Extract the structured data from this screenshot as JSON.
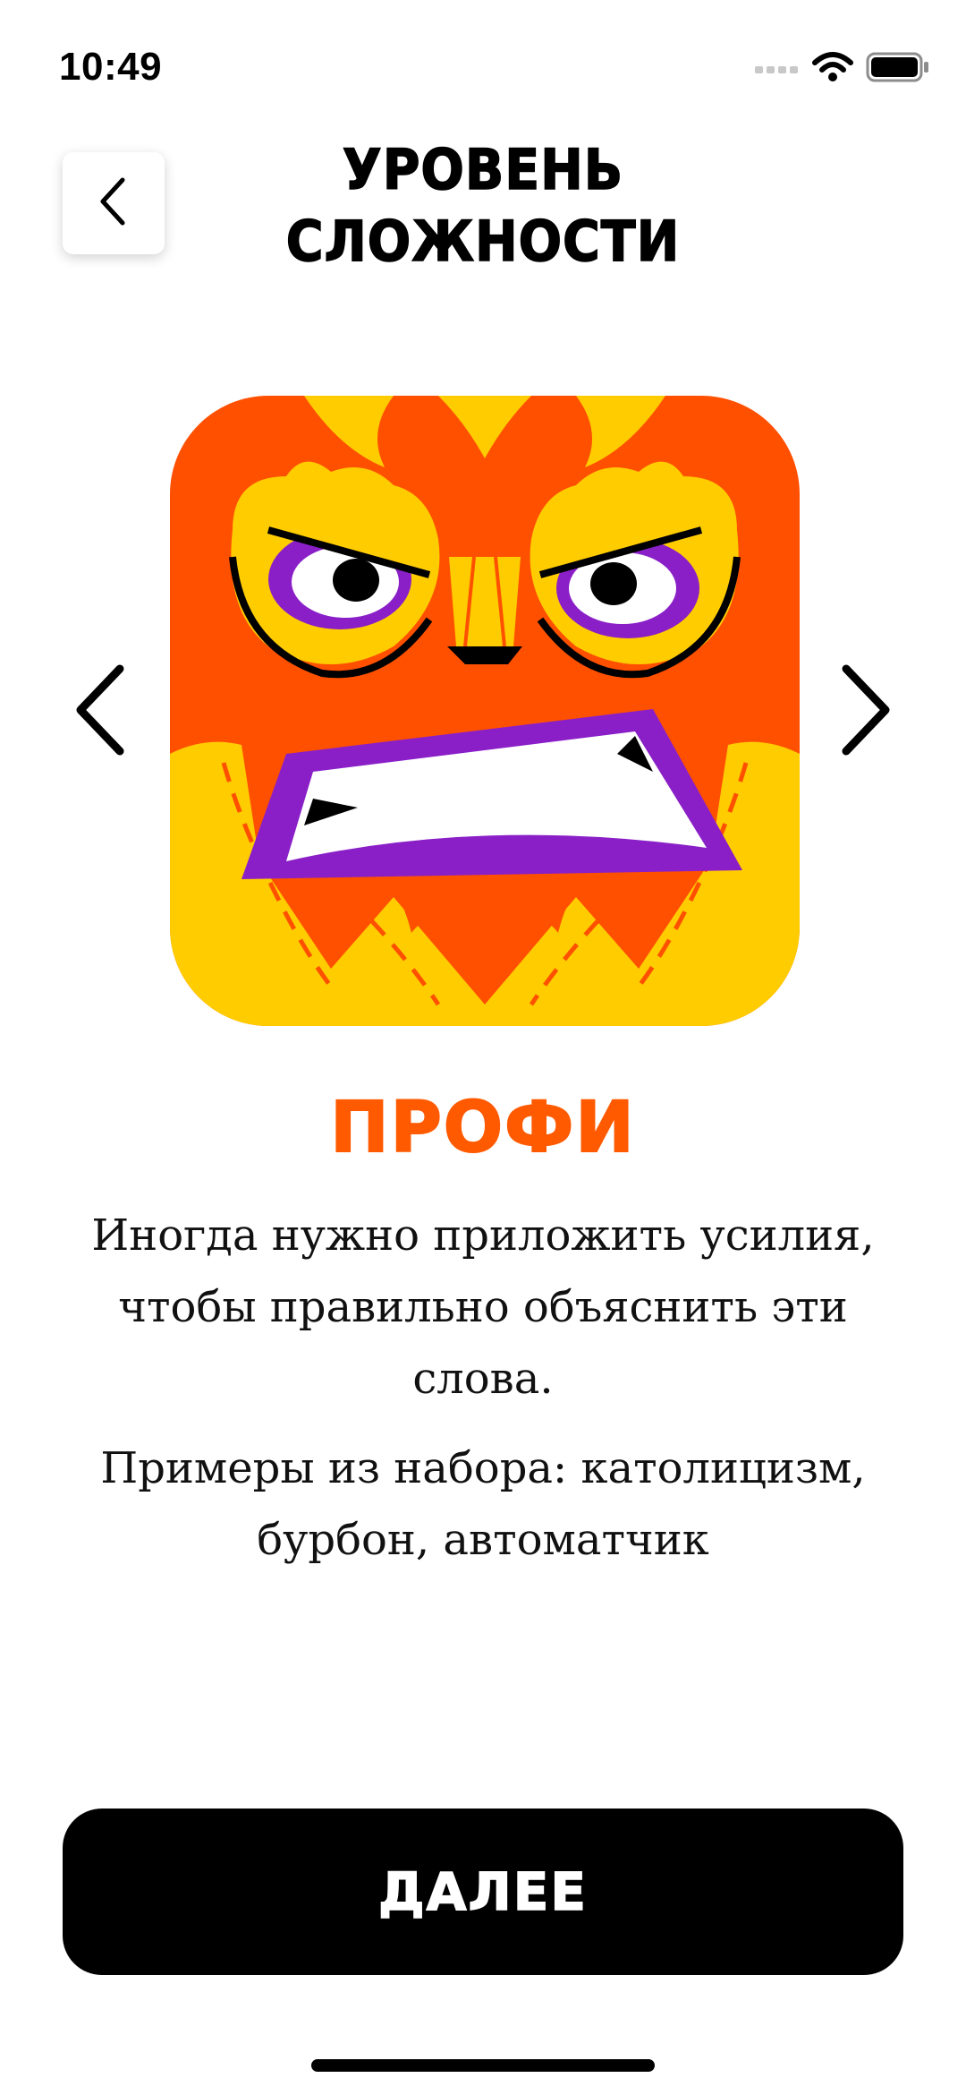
{
  "status_bar": {
    "time": "10:49",
    "icons": [
      "signal-icon",
      "wifi-icon",
      "battery-icon"
    ]
  },
  "header": {
    "back_icon": "chevron-left-icon",
    "title_line1": "УРОВЕНЬ",
    "title_line2": "СЛОЖНОСТИ"
  },
  "carousel": {
    "prev_icon": "chevron-left-icon",
    "next_icon": "chevron-right-icon",
    "mascot_icon": "angry-owl-mascot-icon"
  },
  "level": {
    "name": "ПРОФИ",
    "description": "Иногда нужно приложить усилия, чтобы правильно объяснить эти слова.",
    "examples": "Примеры из набора: католицизм, бурбон, автоматчик"
  },
  "footer": {
    "next_label": "ДАЛЕЕ"
  },
  "colors": {
    "accent": "#ff5a00",
    "mascot_orange": "#ff5000",
    "mascot_yellow": "#ffcc00",
    "mascot_purple": "#8a1fc8",
    "button": "#000000"
  }
}
